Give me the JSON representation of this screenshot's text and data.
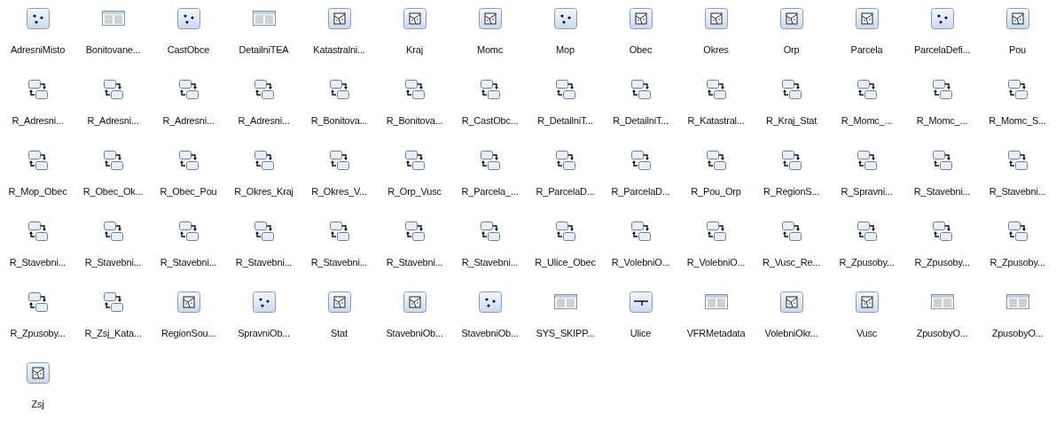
{
  "items": [
    {
      "label": "AdresniMisto",
      "kind": "point"
    },
    {
      "label": "Bonitovane...",
      "kind": "table"
    },
    {
      "label": "CastObce",
      "kind": "point"
    },
    {
      "label": "DetailniTEA",
      "kind": "table"
    },
    {
      "label": "Katastralni...",
      "kind": "polygon"
    },
    {
      "label": "Kraj",
      "kind": "polygon"
    },
    {
      "label": "Momc",
      "kind": "polygon"
    },
    {
      "label": "Mop",
      "kind": "point"
    },
    {
      "label": "Obec",
      "kind": "polygon"
    },
    {
      "label": "Okres",
      "kind": "polygon"
    },
    {
      "label": "Orp",
      "kind": "polygon"
    },
    {
      "label": "Parcela",
      "kind": "polygon"
    },
    {
      "label": "ParcelaDefi...",
      "kind": "point"
    },
    {
      "label": "Pou",
      "kind": "polygon"
    },
    {
      "label": "R_Adresni...",
      "kind": "relationship"
    },
    {
      "label": "R_Adresni...",
      "kind": "relationship"
    },
    {
      "label": "R_Adresni...",
      "kind": "relationship"
    },
    {
      "label": "R_Adresni...",
      "kind": "relationship"
    },
    {
      "label": "R_Bonitova...",
      "kind": "relationship"
    },
    {
      "label": "R_Bonitova...",
      "kind": "relationship"
    },
    {
      "label": "R_CastObc...",
      "kind": "relationship"
    },
    {
      "label": "R_DetailniT...",
      "kind": "relationship"
    },
    {
      "label": "R_DetailniT...",
      "kind": "relationship"
    },
    {
      "label": "R_Katastral...",
      "kind": "relationship"
    },
    {
      "label": "R_Kraj_Stat",
      "kind": "relationship"
    },
    {
      "label": "R_Momc_...",
      "kind": "relationship"
    },
    {
      "label": "R_Momc_...",
      "kind": "relationship"
    },
    {
      "label": "R_Momc_S...",
      "kind": "relationship"
    },
    {
      "label": "R_Mop_Obec",
      "kind": "relationship"
    },
    {
      "label": "R_Obec_Ok...",
      "kind": "relationship"
    },
    {
      "label": "R_Obec_Pou",
      "kind": "relationship"
    },
    {
      "label": "R_Okres_Kraj",
      "kind": "relationship"
    },
    {
      "label": "R_Okres_V...",
      "kind": "relationship"
    },
    {
      "label": "R_Orp_Vusc",
      "kind": "relationship"
    },
    {
      "label": "R_Parcela_...",
      "kind": "relationship"
    },
    {
      "label": "R_ParcelaD...",
      "kind": "relationship"
    },
    {
      "label": "R_ParcelaD...",
      "kind": "relationship"
    },
    {
      "label": "R_Pou_Orp",
      "kind": "relationship"
    },
    {
      "label": "R_RegionS...",
      "kind": "relationship"
    },
    {
      "label": "R_Spravni...",
      "kind": "relationship"
    },
    {
      "label": "R_Stavebni...",
      "kind": "relationship"
    },
    {
      "label": "R_Stavebni...",
      "kind": "relationship"
    },
    {
      "label": "R_Stavebni...",
      "kind": "relationship"
    },
    {
      "label": "R_Stavebni...",
      "kind": "relationship"
    },
    {
      "label": "R_Stavebni...",
      "kind": "relationship"
    },
    {
      "label": "R_Stavebni...",
      "kind": "relationship"
    },
    {
      "label": "R_Stavebni...",
      "kind": "relationship"
    },
    {
      "label": "R_Stavebni...",
      "kind": "relationship"
    },
    {
      "label": "R_Stavebni...",
      "kind": "relationship"
    },
    {
      "label": "R_Ulice_Obec",
      "kind": "relationship"
    },
    {
      "label": "R_VolebniO...",
      "kind": "relationship"
    },
    {
      "label": "R_VolebniO...",
      "kind": "relationship"
    },
    {
      "label": "R_Vusc_Re...",
      "kind": "relationship"
    },
    {
      "label": "R_Zpusoby...",
      "kind": "relationship"
    },
    {
      "label": "R_Zpusoby...",
      "kind": "relationship"
    },
    {
      "label": "R_Zpusoby...",
      "kind": "relationship"
    },
    {
      "label": "R_Zpusoby...",
      "kind": "relationship"
    },
    {
      "label": "R_Zsj_Kata...",
      "kind": "relationship"
    },
    {
      "label": "RegionSou...",
      "kind": "polygon"
    },
    {
      "label": "SpravniOb...",
      "kind": "point"
    },
    {
      "label": "Stat",
      "kind": "polygon"
    },
    {
      "label": "StavebniOb...",
      "kind": "polygon"
    },
    {
      "label": "StavebniOb...",
      "kind": "point"
    },
    {
      "label": "SYS_SKIPP...",
      "kind": "table"
    },
    {
      "label": "Ulice",
      "kind": "line"
    },
    {
      "label": "VFRMetadata",
      "kind": "table"
    },
    {
      "label": "VolebniOkr...",
      "kind": "polygon"
    },
    {
      "label": "Vusc",
      "kind": "polygon"
    },
    {
      "label": "ZpusobyO...",
      "kind": "table"
    },
    {
      "label": "ZpusobyO...",
      "kind": "table"
    },
    {
      "label": "Zsj",
      "kind": "polygon"
    }
  ]
}
